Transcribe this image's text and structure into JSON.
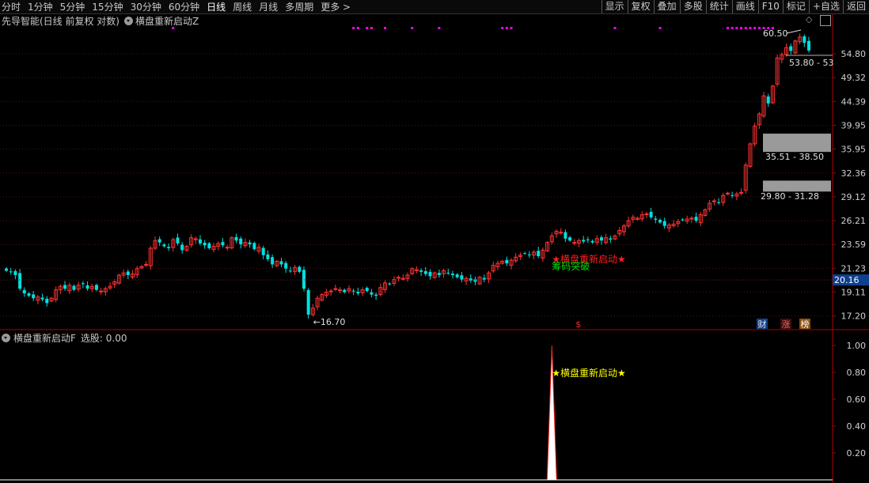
{
  "toolbar": {
    "periods": [
      "分时",
      "1分钟",
      "5分钟",
      "15分钟",
      "30分钟",
      "60分钟",
      "日线",
      "周线",
      "月线",
      "多周期",
      "更多 >"
    ],
    "active_period": "日线",
    "tools": [
      "显示",
      "复权",
      "叠加",
      "多股",
      "统计",
      "画线",
      "F10",
      "标记",
      "+自选",
      "返回"
    ]
  },
  "main_info": {
    "title": "先导智能(日线 前复权 对数)",
    "indicator": "横盘重新启动Z"
  },
  "sub_info": {
    "indicator": "横盘重新启动F",
    "pick_text": "选股: 0.00"
  },
  "colors": {
    "up": "#ff3232",
    "down": "#00e0e0",
    "grid": "#5a1010",
    "axis": "#b00000",
    "yellow": "#ffff00",
    "red_text": "#ff2020",
    "green_text": "#00e000",
    "magenta": "#ff00ff",
    "price_tag": "#0f3f8f"
  },
  "chart_data": [
    {
      "type": "candlestick",
      "title": "先导智能(日线 前复权 对数)",
      "scale": "log",
      "y_ticks": [
        "54.80",
        "49.32",
        "44.39",
        "39.95",
        "35.95",
        "32.36",
        "29.12",
        "26.21",
        "23.59",
        "21.23",
        "19.11",
        "17.20"
      ],
      "current_price": "20.16",
      "annotations": {
        "low_label": "16.70",
        "high_label": "60.50",
        "gap_labels": [
          "53.80 - 53",
          "35.51 - 38.50",
          "29.80 - 31.28"
        ],
        "signal_text": "横盘重新启动",
        "sub_signal_text": "筹码突破",
        "markers": [
          "财",
          "涨",
          "榜"
        ],
        "dollar": "$"
      },
      "closes": [
        21.0,
        20.9,
        20.6,
        19.4,
        19.0,
        18.8,
        18.6,
        18.7,
        18.5,
        18.2,
        18.6,
        19.3,
        19.6,
        19.4,
        19.7,
        19.3,
        19.7,
        19.8,
        19.4,
        19.6,
        19.3,
        19.2,
        19.4,
        19.6,
        20.0,
        20.6,
        20.8,
        20.6,
        20.7,
        21.2,
        21.4,
        21.6,
        23.2,
        24.0,
        23.8,
        23.4,
        23.2,
        24.1,
        23.7,
        23.0,
        23.4,
        24.3,
        24.2,
        23.7,
        23.5,
        23.2,
        23.4,
        23.7,
        23.5,
        23.3,
        24.3,
        24.0,
        23.6,
        23.8,
        23.6,
        23.1,
        23.3,
        22.5,
        22.1,
        21.6,
        21.9,
        21.6,
        21.2,
        21.0,
        21.3,
        20.9,
        19.4,
        17.3,
        17.8,
        18.6,
        18.9,
        19.1,
        19.2,
        19.4,
        19.3,
        19.1,
        19.4,
        19.2,
        19.0,
        19.3,
        19.2,
        18.9,
        18.8,
        19.5,
        19.9,
        19.8,
        20.2,
        20.4,
        20.3,
        20.6,
        21.2,
        21.1,
        20.9,
        20.7,
        20.5,
        20.8,
        20.6,
        21.0,
        20.8,
        20.6,
        20.4,
        20.2,
        20.3,
        20.1,
        20.0,
        20.4,
        20.2,
        20.8,
        21.5,
        21.7,
        21.9,
        21.7,
        22.0,
        22.3,
        22.5,
        22.7,
        22.5,
        22.8,
        22.4,
        23.0,
        23.8,
        24.5,
        25.0,
        24.9,
        24.2,
        24.0,
        23.8,
        24.0,
        23.9,
        24.1,
        23.8,
        24.2,
        24.0,
        24.3,
        24.1,
        24.5,
        25.1,
        25.6,
        26.2,
        26.6,
        26.5,
        26.9,
        27.0,
        26.6,
        26.3,
        26.0,
        25.6,
        25.7,
        25.8,
        26.1,
        26.3,
        26.4,
        26.5,
        26.2,
        26.9,
        27.5,
        28.3,
        28.6,
        28.4,
        29.3,
        29.6,
        29.3,
        29.5,
        29.7,
        33.5,
        36.8,
        39.8,
        42.0,
        45.5,
        44.0,
        47.5,
        53.8,
        54.6,
        56.3,
        55.5,
        58.0,
        59.0,
        57.5,
        55.6
      ],
      "signal_day_index": 121
    },
    {
      "type": "line",
      "title": "横盘重新启动F",
      "y_ticks": [
        "1.00",
        "0.80",
        "0.60",
        "0.40",
        "0.20"
      ],
      "signal_day_index": 121,
      "signal_value": 1.0,
      "signal_text": "横盘重新启动"
    }
  ]
}
